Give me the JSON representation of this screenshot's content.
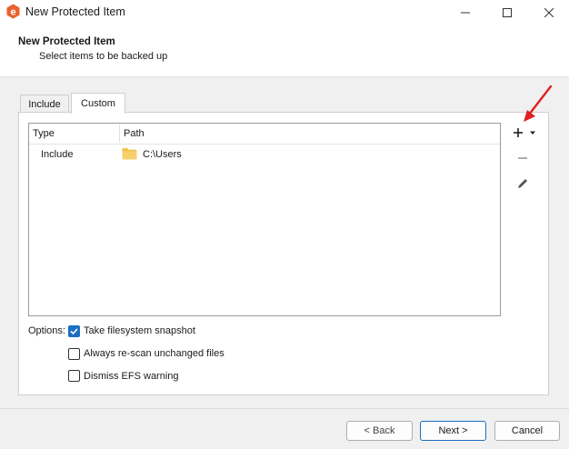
{
  "window": {
    "title": "New Protected Item"
  },
  "header": {
    "title": "New Protected Item",
    "subtitle": "Select items to be backed up"
  },
  "tabs": [
    {
      "label": "Include",
      "selected": false
    },
    {
      "label": "Custom",
      "selected": true
    }
  ],
  "list": {
    "columns": [
      "Type",
      "Path"
    ],
    "rows": [
      {
        "type": "Include",
        "path": "C:\\Users",
        "icon": "folder-icon"
      }
    ]
  },
  "side_actions": {
    "add_icon": "plus-icon",
    "dropdown_icon": "chevron-down-icon",
    "remove_icon": "minus-icon",
    "edit_icon": "pencil-icon"
  },
  "options": {
    "label": "Options:",
    "items": [
      {
        "label": "Take filesystem snapshot",
        "checked": true
      },
      {
        "label": "Always re-scan unchanged files",
        "checked": false
      },
      {
        "label": "Dismiss EFS warning",
        "checked": false
      }
    ]
  },
  "footer": {
    "back_label": "< Back",
    "next_label": "Next >",
    "cancel_label": "Cancel"
  },
  "colors": {
    "accent": "#1c6ec2",
    "annotation_arrow": "#e02020",
    "logo": "#e8612c",
    "folder": "#f2c14e"
  }
}
